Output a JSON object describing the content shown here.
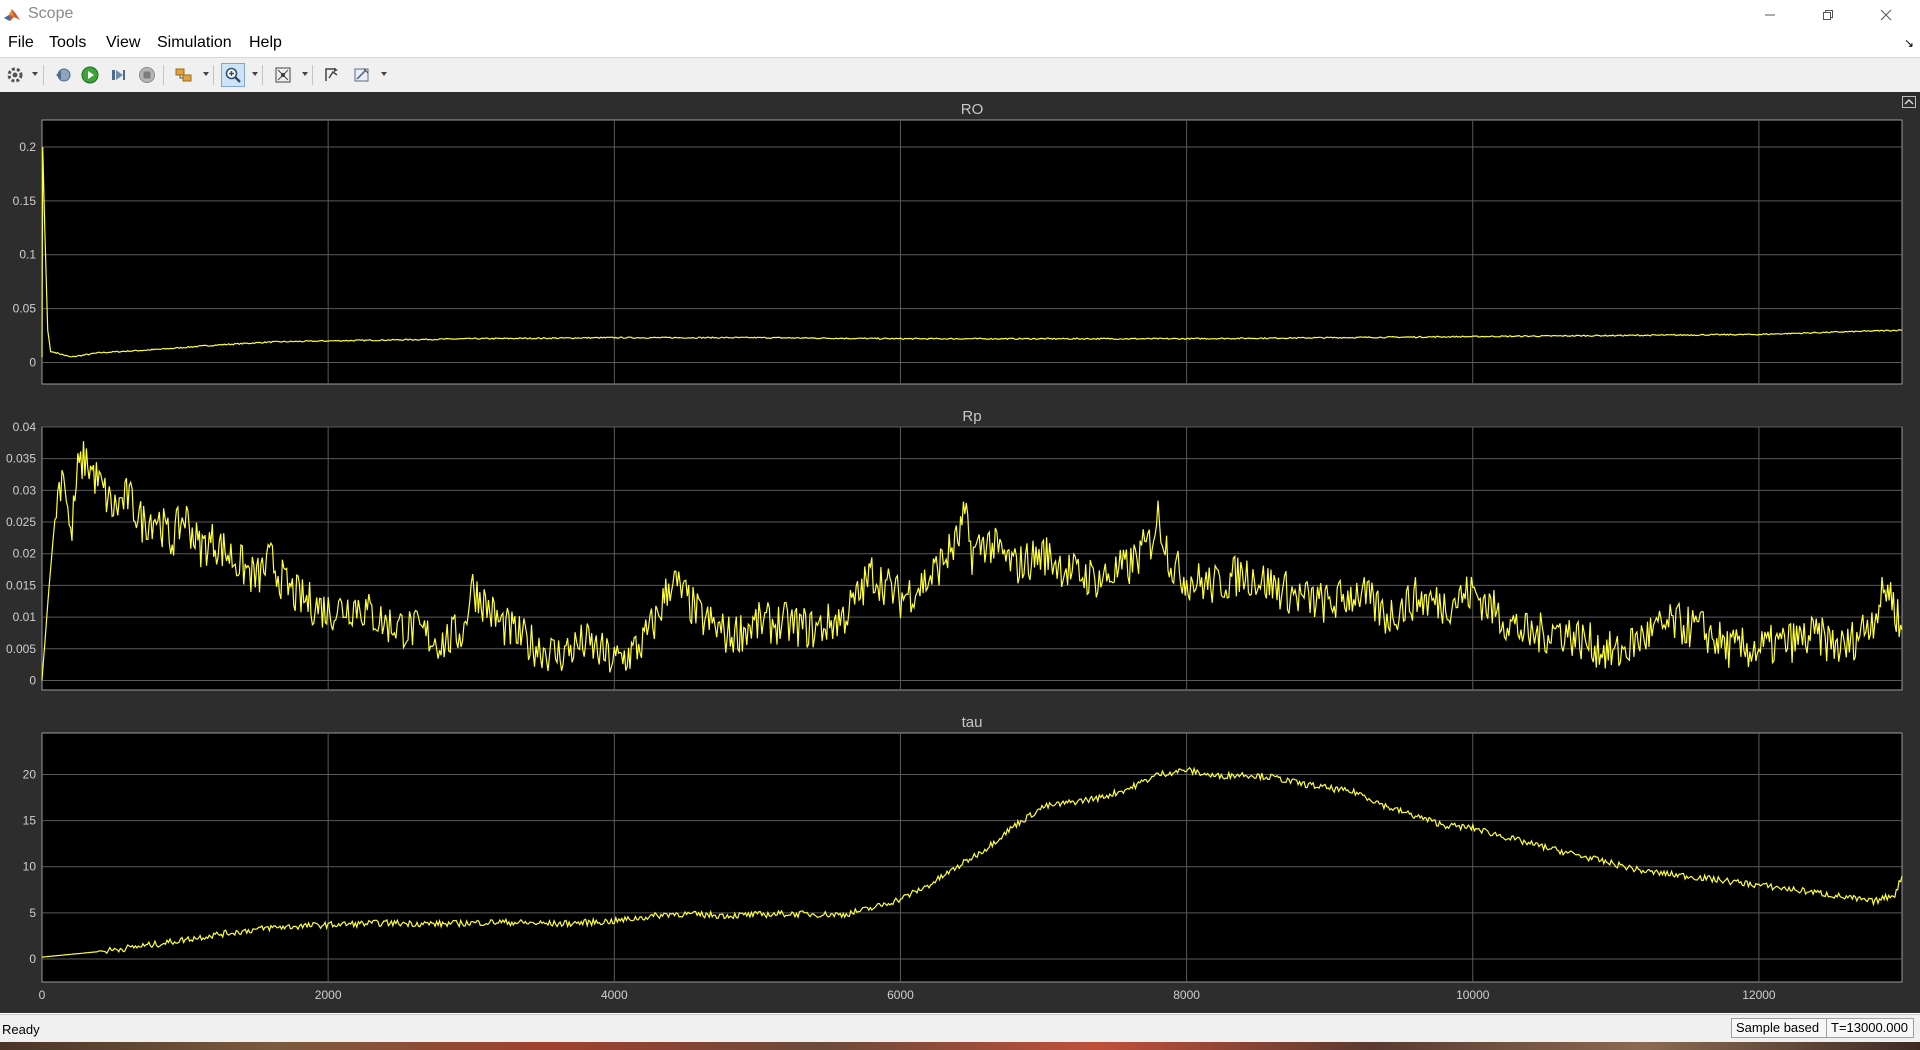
{
  "window": {
    "title": "Scope",
    "controls": [
      "minimize-icon",
      "restore-icon",
      "close-icon"
    ]
  },
  "menu": {
    "items": [
      "File",
      "Tools",
      "View",
      "Simulation",
      "Help"
    ]
  },
  "toolbar": {
    "buttons": [
      "settings-icon",
      "step-back-icon",
      "run-icon",
      "step-forward-icon",
      "stop-icon",
      "highlight-icon",
      "zoom-in-icon",
      "fit-to-view-icon",
      "signal-select-icon",
      "measure-icon"
    ]
  },
  "colors": {
    "plot_background": "#000000",
    "figure_background": "#2d2d2d",
    "trace": "#ffff3a",
    "grid": "#5a5a5a"
  },
  "status": {
    "left": "Ready",
    "mode": "Sample based",
    "time": "T=13000.000"
  },
  "chart_data": [
    {
      "type": "line",
      "title": "RO",
      "xlim": [
        0,
        13000
      ],
      "ylim": [
        -0.02,
        0.225
      ],
      "yticks": [
        0,
        0.05,
        0.1,
        0.15,
        0.2
      ],
      "ytick_labels": [
        "0",
        "0.05",
        "0.1",
        "0.15",
        "0.2"
      ],
      "xticks": [
        0,
        2000,
        4000,
        6000,
        8000,
        10000,
        12000
      ],
      "grid": true,
      "x": [
        0,
        5,
        20,
        40,
        60,
        100,
        200,
        400,
        800,
        1200,
        1600,
        2000,
        3000,
        4000,
        5000,
        6000,
        7000,
        8000,
        9000,
        10000,
        11000,
        12000,
        13000
      ],
      "y": [
        0.005,
        0.2,
        0.12,
        0.03,
        0.01,
        0.009,
        0.005,
        0.009,
        0.012,
        0.016,
        0.019,
        0.02,
        0.022,
        0.023,
        0.023,
        0.022,
        0.022,
        0.022,
        0.023,
        0.024,
        0.025,
        0.026,
        0.03
      ]
    },
    {
      "type": "line",
      "title": "Rp",
      "xlim": [
        0,
        13000
      ],
      "ylim": [
        -0.0015,
        0.04
      ],
      "yticks": [
        0,
        0.005,
        0.01,
        0.015,
        0.02,
        0.025,
        0.03,
        0.035,
        0.04
      ],
      "ytick_labels": [
        "0",
        "0.005",
        "0.01",
        "0.015",
        "0.02",
        "0.025",
        "0.03",
        "0.035",
        "0.04"
      ],
      "xticks": [
        0,
        2000,
        4000,
        6000,
        8000,
        10000,
        12000
      ],
      "grid": true,
      "x": [
        0,
        50,
        100,
        150,
        200,
        250,
        300,
        400,
        500,
        600,
        700,
        800,
        900,
        1000,
        1100,
        1200,
        1300,
        1400,
        1500,
        1600,
        1700,
        1800,
        1900,
        2000,
        2200,
        2400,
        2600,
        2800,
        2950,
        3000,
        3100,
        3200,
        3400,
        3600,
        3800,
        4000,
        4100,
        4200,
        4300,
        4400,
        4500,
        4600,
        4800,
        5000,
        5200,
        5400,
        5600,
        5700,
        5800,
        6000,
        6200,
        6300,
        6400,
        6450,
        6500,
        6600,
        6800,
        7000,
        7200,
        7400,
        7600,
        7750,
        7800,
        7900,
        8000,
        8200,
        8400,
        8600,
        8800,
        9000,
        9200,
        9400,
        9600,
        9800,
        10000,
        10200,
        10400,
        10600,
        10800,
        11000,
        11200,
        11400,
        11600,
        11800,
        12000,
        12200,
        12400,
        12600,
        12800,
        12900,
        13000
      ],
      "y": [
        0.0,
        0.015,
        0.028,
        0.034,
        0.022,
        0.033,
        0.035,
        0.031,
        0.027,
        0.029,
        0.025,
        0.026,
        0.022,
        0.026,
        0.021,
        0.022,
        0.02,
        0.018,
        0.016,
        0.019,
        0.015,
        0.013,
        0.012,
        0.011,
        0.012,
        0.009,
        0.008,
        0.006,
        0.008,
        0.015,
        0.012,
        0.009,
        0.006,
        0.004,
        0.006,
        0.003,
        0.004,
        0.006,
        0.01,
        0.016,
        0.013,
        0.01,
        0.007,
        0.009,
        0.009,
        0.008,
        0.01,
        0.013,
        0.017,
        0.013,
        0.016,
        0.019,
        0.022,
        0.026,
        0.02,
        0.022,
        0.018,
        0.02,
        0.017,
        0.016,
        0.018,
        0.022,
        0.026,
        0.018,
        0.016,
        0.015,
        0.017,
        0.015,
        0.013,
        0.012,
        0.014,
        0.01,
        0.013,
        0.012,
        0.014,
        0.01,
        0.007,
        0.008,
        0.006,
        0.004,
        0.007,
        0.009,
        0.008,
        0.005,
        0.005,
        0.006,
        0.007,
        0.005,
        0.01,
        0.015,
        0.008
      ]
    },
    {
      "type": "line",
      "title": "tau",
      "xlim": [
        0,
        13000
      ],
      "ylim": [
        -2.5,
        24.5
      ],
      "yticks": [
        0,
        5,
        10,
        15,
        20
      ],
      "ytick_labels": [
        "0",
        "5",
        "10",
        "15",
        "20"
      ],
      "xticks": [
        0,
        2000,
        4000,
        6000,
        8000,
        10000,
        12000
      ],
      "xtick_labels": [
        "0",
        "2000",
        "4000",
        "6000",
        "8000",
        "10000",
        "12000"
      ],
      "grid": true,
      "x": [
        0,
        400,
        800,
        1200,
        1600,
        2000,
        2400,
        2800,
        3200,
        3600,
        4000,
        4400,
        4800,
        5200,
        5600,
        5800,
        6000,
        6200,
        6400,
        6600,
        6800,
        7000,
        7200,
        7400,
        7600,
        7800,
        8000,
        8200,
        8400,
        8600,
        8800,
        9000,
        9200,
        9400,
        9600,
        9800,
        10000,
        10400,
        10800,
        11200,
        11600,
        12000,
        12400,
        12800,
        12950,
        13000
      ],
      "y": [
        0.2,
        0.8,
        1.6,
        2.6,
        3.4,
        3.7,
        3.9,
        3.8,
        4.0,
        3.8,
        4.1,
        4.9,
        4.7,
        4.9,
        4.8,
        5.5,
        6.5,
        8.0,
        10.0,
        12.0,
        14.5,
        16.5,
        17.0,
        17.5,
        18.5,
        20.0,
        20.5,
        19.8,
        20.0,
        19.7,
        19.0,
        18.5,
        18.0,
        16.5,
        15.5,
        14.5,
        14.2,
        12.5,
        11.0,
        9.5,
        8.8,
        8.0,
        7.2,
        6.2,
        7.0,
        9.0
      ]
    }
  ]
}
